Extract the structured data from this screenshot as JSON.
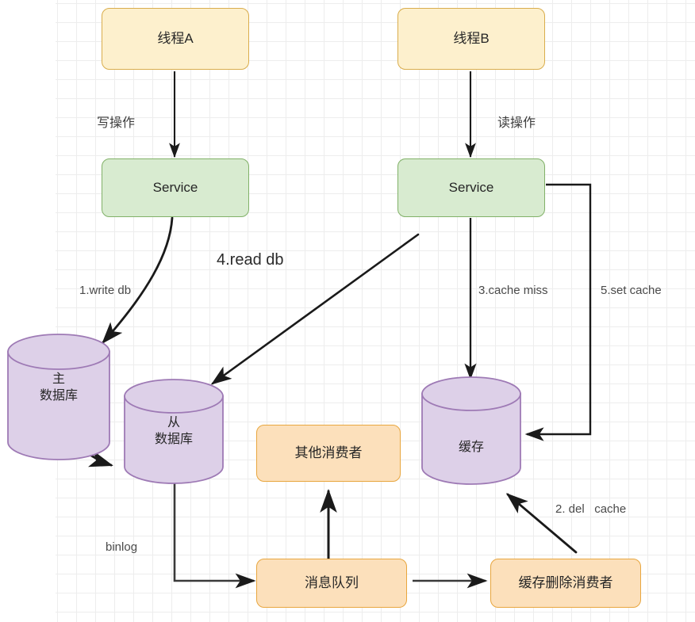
{
  "diagram": {
    "title": "cache-consistency-flow",
    "colors": {
      "yellow_fill": "#fdf0cd",
      "yellow_stroke": "#d9ad4c",
      "green_fill": "#d8ebd0",
      "green_stroke": "#81b168",
      "orange_fill": "#fce0bb",
      "orange_stroke": "#e8a63f",
      "purple_fill": "#ddd0e8",
      "purple_stroke": "#9e7ab5",
      "arrow": "#1a1a1a",
      "text": "#262626",
      "grid": "#ededed"
    },
    "nodes": {
      "thread_a": "线程A",
      "thread_b": "线程B",
      "service_write": "Service",
      "service_read": "Service",
      "master_db": "主\n数据库",
      "slave_db": "从\n数据库",
      "other_consumer": "其他消费者",
      "cache": "缓存",
      "message_queue": "消息队列",
      "cache_delete_consumer": "缓存删除消费者"
    },
    "edge_labels": {
      "write_op": "写操作",
      "read_op": "读操作",
      "write_db": "1.write db",
      "read_db": "4.read db",
      "cache_miss": "3.cache miss",
      "set_cache": "5.set cache",
      "del_cache": "2. del   cache",
      "binlog": "binlog"
    }
  }
}
